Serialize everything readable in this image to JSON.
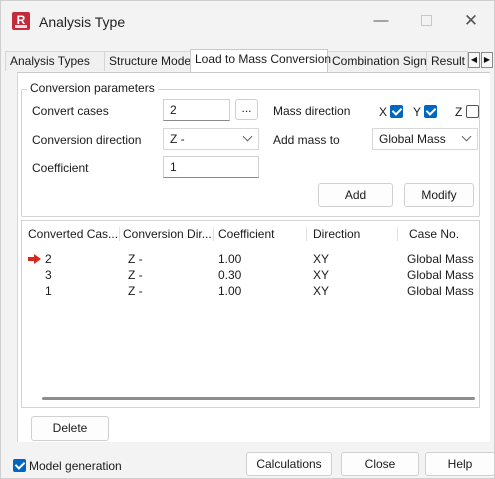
{
  "window": {
    "title": "Analysis Type",
    "app_icon_letter": "R",
    "minimize_glyph": "—",
    "close_glyph": "✕"
  },
  "tabs": [
    {
      "label": "Analysis Types",
      "active": false
    },
    {
      "label": "Structure Model",
      "active": false
    },
    {
      "label": "Load to Mass Conversion",
      "active": true
    },
    {
      "label": "Combination Sign",
      "active": false
    },
    {
      "label": "Result",
      "active": false
    }
  ],
  "tab_scroll": {
    "left": "◀",
    "right": "▶"
  },
  "conversion": {
    "group_title": "Conversion parameters",
    "convert_cases_label": "Convert cases",
    "convert_cases_value": "2",
    "browse_label": "...",
    "conversion_direction_label": "Conversion direction",
    "conversion_direction_value": "Z -",
    "coefficient_label": "Coefficient",
    "coefficient_value": "1",
    "mass_direction_label": "Mass direction",
    "mass_direction": [
      {
        "axis": "X",
        "checked": true
      },
      {
        "axis": "Y",
        "checked": true
      },
      {
        "axis": "Z",
        "checked": false
      }
    ],
    "add_mass_to_label": "Add mass to",
    "add_mass_to_value": "Global Mass",
    "add_button": "Add",
    "modify_button": "Modify"
  },
  "table": {
    "columns": [
      "Converted Cas...",
      "Conversion Dir...",
      "Coefficient",
      "Direction",
      "Case No."
    ],
    "rows": [
      {
        "case": "2",
        "dir": "Z -",
        "coef": "1.00",
        "direction": "XY",
        "case_no": "Global Mass",
        "current": true
      },
      {
        "case": "3",
        "dir": "Z -",
        "coef": "0.30",
        "direction": "XY",
        "case_no": "Global Mass",
        "current": false
      },
      {
        "case": "1",
        "dir": "Z -",
        "coef": "1.00",
        "direction": "XY",
        "case_no": "Global Mass",
        "current": false
      }
    ]
  },
  "delete_button": "Delete",
  "footer": {
    "model_generation_label": "Model generation",
    "model_generation_checked": true,
    "calculations_button": "Calculations",
    "close_button": "Close",
    "help_button": "Help"
  },
  "colors": {
    "accent": "#0067c0",
    "app_icon": "#c42b3a",
    "current_row_arrow": "#d6281e"
  },
  "icons": [
    "app-logo-icon",
    "minimize-icon",
    "maximize-icon",
    "close-icon",
    "chevron-down-icon",
    "checkbox-icon",
    "current-row-arrow-icon",
    "tab-scroll-left-icon",
    "tab-scroll-right-icon"
  ]
}
